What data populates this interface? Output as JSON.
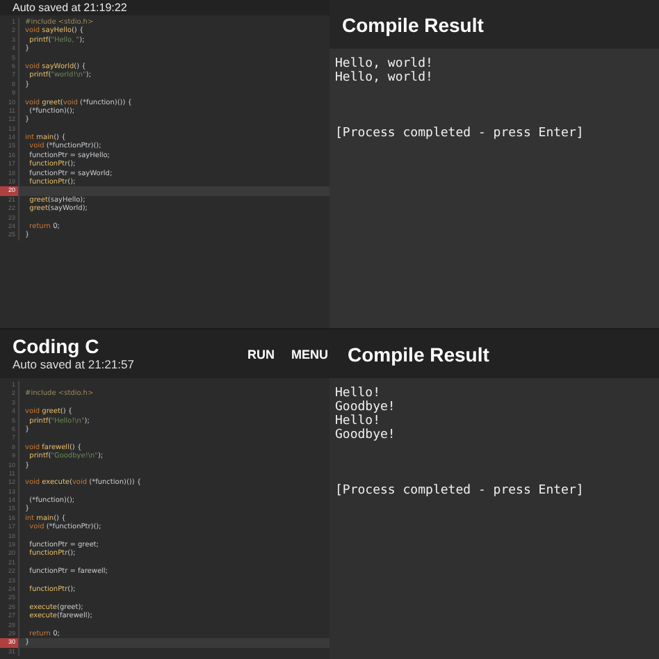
{
  "top": {
    "autosave": "Auto saved at 21:19:22",
    "code": [
      {
        "n": "1",
        "current": false,
        "segs": [
          {
            "t": "#include <stdio.h>",
            "kind": "pre"
          }
        ]
      },
      {
        "n": "2",
        "current": false,
        "segs": [
          {
            "t": "void ",
            "kind": "kw"
          },
          {
            "t": "sayHello",
            "kind": "fn"
          },
          {
            "t": "() {",
            "kind": "plain"
          }
        ]
      },
      {
        "n": "3",
        "current": false,
        "segs": [
          {
            "t": "  printf",
            "kind": "fn"
          },
          {
            "t": "(",
            "kind": "plain"
          },
          {
            "t": "\"Hello, \"",
            "kind": "str"
          },
          {
            "t": ");",
            "kind": "plain"
          }
        ]
      },
      {
        "n": "4",
        "current": false,
        "segs": [
          {
            "t": "}",
            "kind": "plain"
          }
        ]
      },
      {
        "n": "5",
        "current": false
      },
      {
        "n": "6",
        "current": false,
        "segs": [
          {
            "t": "void ",
            "kind": "kw"
          },
          {
            "t": "sayWorld",
            "kind": "fn"
          },
          {
            "t": "() {",
            "kind": "plain"
          }
        ]
      },
      {
        "n": "7",
        "current": false,
        "segs": [
          {
            "t": "  printf",
            "kind": "fn"
          },
          {
            "t": "(",
            "kind": "plain"
          },
          {
            "t": "\"world!\\n\"",
            "kind": "str"
          },
          {
            "t": ");",
            "kind": "plain"
          }
        ]
      },
      {
        "n": "8",
        "current": false,
        "segs": [
          {
            "t": "}",
            "kind": "plain"
          }
        ]
      },
      {
        "n": "9",
        "current": false
      },
      {
        "n": "10",
        "current": false,
        "segs": [
          {
            "t": "void ",
            "kind": "kw"
          },
          {
            "t": "greet",
            "kind": "fn"
          },
          {
            "t": "(",
            "kind": "plain"
          },
          {
            "t": "void ",
            "kind": "kw"
          },
          {
            "t": "(*function)()) {",
            "kind": "plain"
          }
        ]
      },
      {
        "n": "11",
        "current": false,
        "segs": [
          {
            "t": "  (*function)();",
            "kind": "plain"
          }
        ]
      },
      {
        "n": "12",
        "current": false,
        "segs": [
          {
            "t": "}",
            "kind": "plain"
          }
        ]
      },
      {
        "n": "13",
        "current": false
      },
      {
        "n": "14",
        "current": false,
        "segs": [
          {
            "t": "int ",
            "kind": "kw"
          },
          {
            "t": "main",
            "kind": "fn"
          },
          {
            "t": "() {",
            "kind": "plain"
          }
        ]
      },
      {
        "n": "15",
        "current": false,
        "segs": [
          {
            "t": "  void ",
            "kind": "kw"
          },
          {
            "t": "(*functionPtr)();",
            "kind": "plain"
          }
        ]
      },
      {
        "n": "16",
        "current": false,
        "segs": [
          {
            "t": "  functionPtr = sayHello;",
            "kind": "plain"
          }
        ]
      },
      {
        "n": "17",
        "current": false,
        "segs": [
          {
            "t": "  functionPtr",
            "kind": "fn"
          },
          {
            "t": "();",
            "kind": "plain"
          }
        ]
      },
      {
        "n": "18",
        "current": false,
        "segs": [
          {
            "t": "  functionPtr = sayWorld;",
            "kind": "plain"
          }
        ]
      },
      {
        "n": "19",
        "current": false,
        "segs": [
          {
            "t": "  functionPtr",
            "kind": "fn"
          },
          {
            "t": "();",
            "kind": "plain"
          }
        ]
      },
      {
        "n": "20",
        "current": true
      },
      {
        "n": "21",
        "current": false,
        "segs": [
          {
            "t": "  greet",
            "kind": "fn"
          },
          {
            "t": "(sayHello);",
            "kind": "plain"
          }
        ]
      },
      {
        "n": "22",
        "current": false,
        "segs": [
          {
            "t": "  greet",
            "kind": "fn"
          },
          {
            "t": "(sayWorld);",
            "kind": "plain"
          }
        ]
      },
      {
        "n": "23",
        "current": false
      },
      {
        "n": "24",
        "current": false,
        "segs": [
          {
            "t": "  return ",
            "kind": "kw"
          },
          {
            "t": "0;",
            "kind": "plain"
          }
        ]
      },
      {
        "n": "25",
        "current": false,
        "segs": [
          {
            "t": "}",
            "kind": "plain"
          }
        ]
      }
    ],
    "result_title": "Compile Result",
    "output": [
      "Hello, world!",
      "Hello, world!"
    ],
    "status": "[Process completed - press Enter]"
  },
  "bottom": {
    "title": "Coding C",
    "autosave": "Auto saved at 21:21:57",
    "actions": [
      "RUN",
      "MENU"
    ],
    "code": [
      {
        "n": "1",
        "current": false
      },
      {
        "n": "2",
        "current": false,
        "segs": [
          {
            "t": "#include <stdio.h>",
            "kind": "pre"
          }
        ]
      },
      {
        "n": "3",
        "current": false
      },
      {
        "n": "4",
        "current": false,
        "segs": [
          {
            "t": "void ",
            "kind": "kw"
          },
          {
            "t": "greet",
            "kind": "fn"
          },
          {
            "t": "() {",
            "kind": "plain"
          }
        ]
      },
      {
        "n": "5",
        "current": false,
        "segs": [
          {
            "t": "  printf",
            "kind": "fn"
          },
          {
            "t": "(",
            "kind": "plain"
          },
          {
            "t": "\"Hello!\\n\"",
            "kind": "str"
          },
          {
            "t": ");",
            "kind": "plain"
          }
        ]
      },
      {
        "n": "6",
        "current": false,
        "segs": [
          {
            "t": "}",
            "kind": "plain"
          }
        ]
      },
      {
        "n": "7",
        "current": false
      },
      {
        "n": "8",
        "current": false,
        "segs": [
          {
            "t": "void ",
            "kind": "kw"
          },
          {
            "t": "farewell",
            "kind": "fn"
          },
          {
            "t": "() {",
            "kind": "plain"
          }
        ]
      },
      {
        "n": "9",
        "current": false,
        "segs": [
          {
            "t": "  printf",
            "kind": "fn"
          },
          {
            "t": "(",
            "kind": "plain"
          },
          {
            "t": "\"Goodbye!\\n\"",
            "kind": "str"
          },
          {
            "t": ");",
            "kind": "plain"
          }
        ]
      },
      {
        "n": "10",
        "current": false,
        "segs": [
          {
            "t": "}",
            "kind": "plain"
          }
        ]
      },
      {
        "n": "11",
        "current": false
      },
      {
        "n": "12",
        "current": false,
        "segs": [
          {
            "t": "void ",
            "kind": "kw"
          },
          {
            "t": "execute",
            "kind": "fn"
          },
          {
            "t": "(",
            "kind": "plain"
          },
          {
            "t": "void ",
            "kind": "kw"
          },
          {
            "t": "(*function)()) {",
            "kind": "plain"
          }
        ]
      },
      {
        "n": "13",
        "current": false
      },
      {
        "n": "14",
        "current": false,
        "segs": [
          {
            "t": "  (*function)();",
            "kind": "plain"
          }
        ]
      },
      {
        "n": "15",
        "current": false,
        "segs": [
          {
            "t": "}",
            "kind": "plain"
          }
        ]
      },
      {
        "n": "16",
        "current": false,
        "segs": [
          {
            "t": "int ",
            "kind": "kw"
          },
          {
            "t": "main",
            "kind": "fn"
          },
          {
            "t": "() {",
            "kind": "plain"
          }
        ]
      },
      {
        "n": "17",
        "current": false,
        "segs": [
          {
            "t": "  void ",
            "kind": "kw"
          },
          {
            "t": "(*functionPtr)();",
            "kind": "plain"
          }
        ]
      },
      {
        "n": "18",
        "current": false
      },
      {
        "n": "19",
        "current": false,
        "segs": [
          {
            "t": "  functionPtr = greet;",
            "kind": "plain"
          }
        ]
      },
      {
        "n": "20",
        "current": false,
        "segs": [
          {
            "t": "  functionPtr",
            "kind": "fn"
          },
          {
            "t": "();",
            "kind": "plain"
          }
        ]
      },
      {
        "n": "21",
        "current": false
      },
      {
        "n": "22",
        "current": false,
        "segs": [
          {
            "t": "  functionPtr = farewell;",
            "kind": "plain"
          }
        ]
      },
      {
        "n": "23",
        "current": false
      },
      {
        "n": "24",
        "current": false,
        "segs": [
          {
            "t": "  functionPtr",
            "kind": "fn"
          },
          {
            "t": "();",
            "kind": "plain"
          }
        ]
      },
      {
        "n": "25",
        "current": false
      },
      {
        "n": "26",
        "current": false,
        "segs": [
          {
            "t": "  execute",
            "kind": "fn"
          },
          {
            "t": "(greet);",
            "kind": "plain"
          }
        ]
      },
      {
        "n": "27",
        "current": false,
        "segs": [
          {
            "t": "  execute",
            "kind": "fn"
          },
          {
            "t": "(farewell);",
            "kind": "plain"
          }
        ]
      },
      {
        "n": "28",
        "current": false
      },
      {
        "n": "29",
        "current": false,
        "segs": [
          {
            "t": "  return ",
            "kind": "kw"
          },
          {
            "t": "0;",
            "kind": "plain"
          }
        ]
      },
      {
        "n": "30",
        "current": true,
        "segs": [
          {
            "t": "}",
            "kind": "plain"
          }
        ]
      },
      {
        "n": "31",
        "current": false
      }
    ],
    "result_title": "Compile Result",
    "output": [
      "Hello!",
      "Goodbye!",
      "Hello!",
      "Goodbye!"
    ],
    "status": "[Process completed - press Enter]"
  }
}
